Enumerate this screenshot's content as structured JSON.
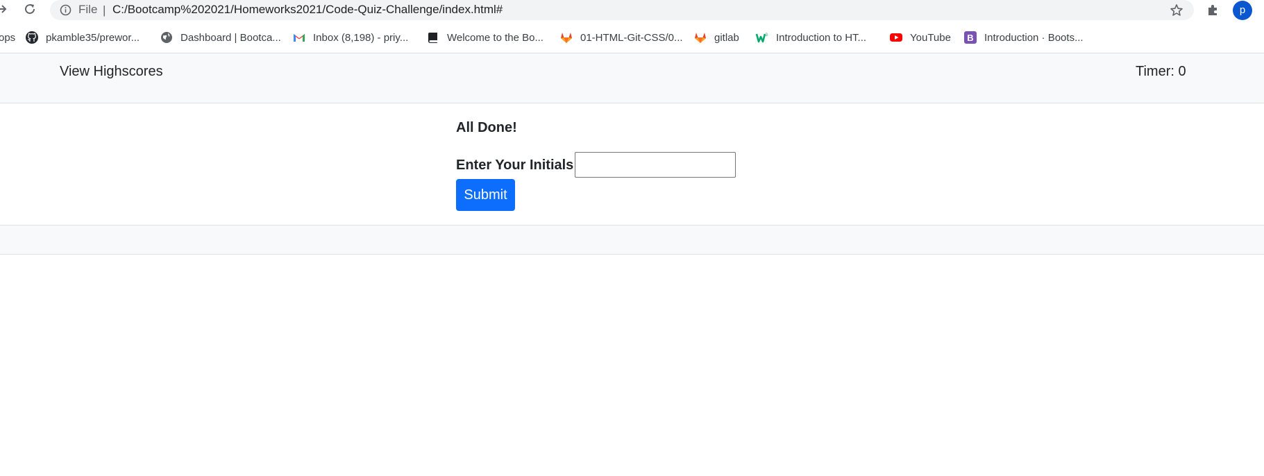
{
  "browser": {
    "file_label": "File",
    "separator": "|",
    "url": "C:/Bootcamp%202021/Homeworks2021/Code-Quiz-Challenge/index.html#",
    "profile_initial": "p"
  },
  "bookmarks": [
    {
      "label": "ops",
      "icon": "apps-icon"
    },
    {
      "label": "pkamble35/prewor...",
      "icon": "github-icon"
    },
    {
      "label": "Dashboard | Bootca...",
      "icon": "globe-icon"
    },
    {
      "label": "Inbox (8,198) - priy...",
      "icon": "gmail-icon"
    },
    {
      "label": "Welcome to the Bo...",
      "icon": "book-icon"
    },
    {
      "label": "01-HTML-Git-CSS/0...",
      "icon": "gitlab-icon"
    },
    {
      "label": "gitlab",
      "icon": "gitlab-icon"
    },
    {
      "label": "Introduction to HT...",
      "icon": "w3schools-icon"
    },
    {
      "label": "YouTube",
      "icon": "youtube-icon"
    },
    {
      "label": "Introduction · Boots...",
      "icon": "bootstrap-icon"
    }
  ],
  "header": {
    "view_highscores": "View Highscores",
    "timer_label": "Timer:",
    "timer_value": "0"
  },
  "quiz": {
    "heading": "All Done!",
    "initials_label": "Enter Your Initials",
    "initials_value": "",
    "submit_label": "Submit"
  },
  "colors": {
    "primary_button": "#0d6efd",
    "header_bg": "#f8f9fa",
    "gitlab_orange": "#e24329",
    "youtube_red": "#ff0000",
    "bootstrap_purple": "#7952b3",
    "gmail_red": "#ea4335",
    "w3_green": "#04aa6d"
  }
}
